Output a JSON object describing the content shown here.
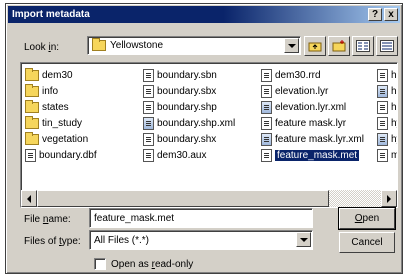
{
  "window": {
    "title": "Import metadata",
    "help_button": "?",
    "close_button": "x"
  },
  "lookin": {
    "label_before": "Look ",
    "label_accel": "i",
    "label_after": "n:",
    "value": "Yellowstone"
  },
  "toolbar": {
    "icons": [
      "up-folder-icon",
      "new-folder-icon",
      "list-view-icon",
      "details-view-icon"
    ]
  },
  "files": {
    "columns": [
      [
        {
          "name": "dem30",
          "type": "folder"
        },
        {
          "name": "info",
          "type": "folder"
        },
        {
          "name": "states",
          "type": "folder"
        },
        {
          "name": "tin_study",
          "type": "folder"
        },
        {
          "name": "vegetation",
          "type": "folder"
        },
        {
          "name": "boundary.dbf",
          "type": "file"
        }
      ],
      [
        {
          "name": "boundary.sbn",
          "type": "file"
        },
        {
          "name": "boundary.sbx",
          "type": "file"
        },
        {
          "name": "boundary.shp",
          "type": "file"
        },
        {
          "name": "boundary.shp.xml",
          "type": "layer"
        },
        {
          "name": "boundary.shx",
          "type": "file"
        },
        {
          "name": "dem30.aux",
          "type": "file"
        }
      ],
      [
        {
          "name": "dem30.rrd",
          "type": "file"
        },
        {
          "name": "elevation.lyr",
          "type": "file"
        },
        {
          "name": "elevation.lyr.xml",
          "type": "layer"
        },
        {
          "name": "feature mask.lyr",
          "type": "file"
        },
        {
          "name": "feature mask.lyr.xml",
          "type": "layer"
        },
        {
          "name": "feature_mask.met",
          "type": "file",
          "selected": true
        }
      ],
      [
        {
          "name": "hills",
          "type": "file"
        },
        {
          "name": "hills",
          "type": "layer"
        },
        {
          "name": "hills",
          "type": "file"
        },
        {
          "name": "hyd",
          "type": "file"
        },
        {
          "name": "hyd",
          "type": "layer"
        },
        {
          "name": "ma",
          "type": "file"
        }
      ]
    ]
  },
  "filename": {
    "label_before": "File ",
    "label_accel": "n",
    "label_after": "ame:",
    "value": "feature_mask.met"
  },
  "filetype": {
    "label_before": "Files of ",
    "label_accel": "t",
    "label_after": "ype:",
    "value": "All Files (*.*)"
  },
  "buttons": {
    "open_accel": "O",
    "open_rest": "pen",
    "cancel": "Cancel"
  },
  "readonly": {
    "label_before": "Open as ",
    "label_accel": "r",
    "label_after": "ead-only"
  },
  "colors": {
    "titlebar": "#0a246a",
    "face": "#d4d0c8",
    "selection": "#0a246a"
  }
}
